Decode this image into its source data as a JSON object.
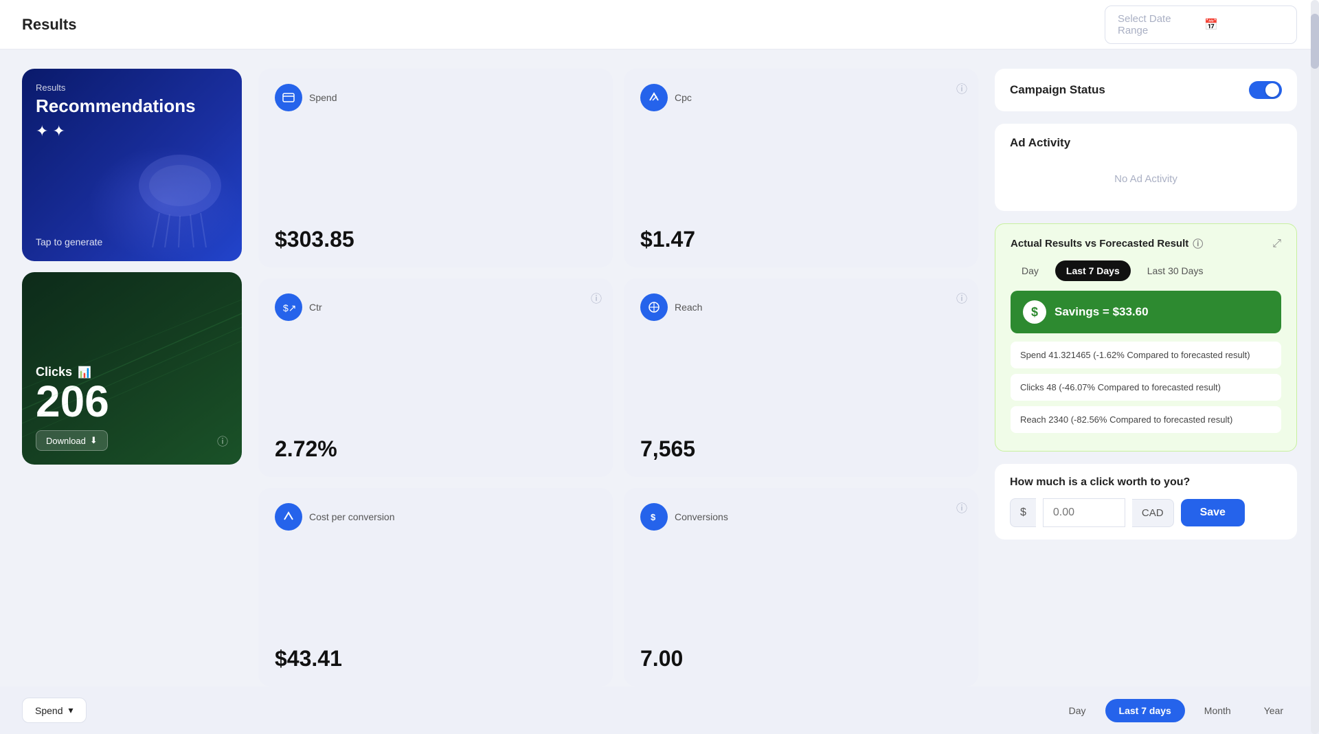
{
  "header": {
    "title": "Results",
    "date_range_placeholder": "Select Date Range",
    "date_range_value": ""
  },
  "left": {
    "recommendations": {
      "label": "Results",
      "title": "Recommendations",
      "sparkle": "✦ ✦",
      "tap": "Tap to generate"
    },
    "clicks": {
      "title": "Clicks",
      "number": "206",
      "download_label": "Download",
      "icon_label": "ⓘ"
    }
  },
  "metrics": [
    {
      "id": "spend",
      "label": "Spend",
      "value": "$303.85",
      "icon": "📺",
      "has_info": false
    },
    {
      "id": "cpc",
      "label": "Cpc",
      "value": "$1.47",
      "icon": "↗",
      "has_info": true
    },
    {
      "id": "ctr",
      "label": "Ctr",
      "value": "2.72%",
      "icon": "$↗",
      "has_info": true
    },
    {
      "id": "reach",
      "label": "Reach",
      "value": "7,565",
      "icon": "⛶",
      "has_info": true
    },
    {
      "id": "cost_per_conversion",
      "label": "Cost per conversion",
      "value": "$43.41",
      "icon": "↗",
      "has_info": false
    },
    {
      "id": "conversions",
      "label": "Conversions",
      "value": "7.00",
      "icon": "$",
      "has_info": true
    }
  ],
  "right": {
    "campaign_status": {
      "label": "Campaign Status",
      "toggle_on": true
    },
    "ad_activity": {
      "title": "Ad Activity",
      "no_activity_text": "No Ad Activity"
    },
    "forecasted": {
      "title": "Actual Results vs Forecasted Result",
      "external_icon": "⤢",
      "tabs": [
        "Day",
        "Last 7 Days",
        "Last 30 Days"
      ],
      "active_tab": "Last 7 Days",
      "savings_label": "Savings = $33.60",
      "rows": [
        "Spend 41.321465 (-1.62% Compared to forecasted result)",
        "Clicks 48  (-46.07% Compared to forecasted result)",
        "Reach 2340 (-82.56% Compared to forecasted result)"
      ]
    },
    "click_worth": {
      "title": "How much is a click worth to you?",
      "dollar_sign": "$",
      "placeholder": "0.00",
      "currency": "CAD",
      "save_label": "Save"
    }
  },
  "bottom_bar": {
    "metric_select": "Spend",
    "dropdown_icon": "▾",
    "periods": [
      "Day",
      "Last 7 days",
      "Month",
      "Year"
    ],
    "active_period": "Last 7 days"
  }
}
